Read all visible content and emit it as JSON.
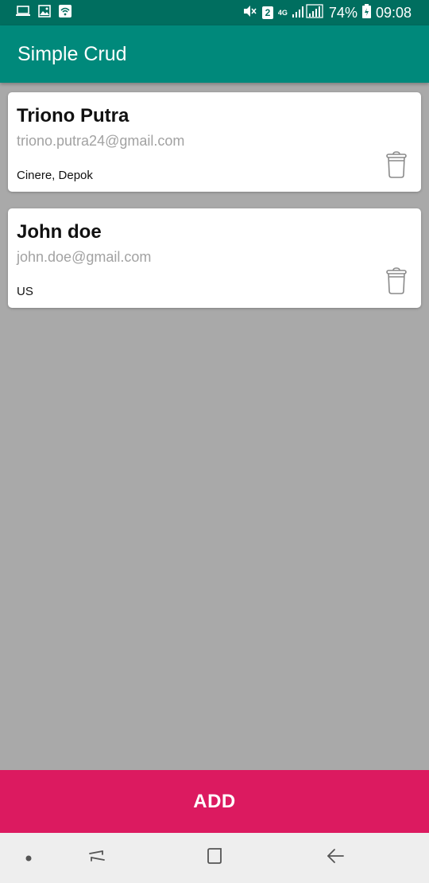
{
  "status_bar": {
    "sim_slot": "2",
    "network": "4G",
    "battery": "74%",
    "time": "09:08",
    "icons": [
      "monitor-icon",
      "image-icon",
      "wifi-hotspot-icon",
      "mute-icon",
      "signal-icon",
      "battery-icon"
    ]
  },
  "app_bar": {
    "title": "Simple Crud"
  },
  "contacts": [
    {
      "name": "Triono Putra",
      "email": "triono.putra24@gmail.com",
      "address": "Cinere, Depok"
    },
    {
      "name": "John doe",
      "email": "john.doe@gmail.com",
      "address": "US"
    }
  ],
  "actions": {
    "add_label": "ADD"
  },
  "colors": {
    "status_bar": "#006e5f",
    "app_bar": "#00897b",
    "background": "#a9a9a9",
    "add_button": "#dc1a60",
    "email_text": "#a2a2a2"
  },
  "nav_icons": [
    "dot-icon",
    "recent-apps-icon",
    "home-icon",
    "back-icon"
  ]
}
